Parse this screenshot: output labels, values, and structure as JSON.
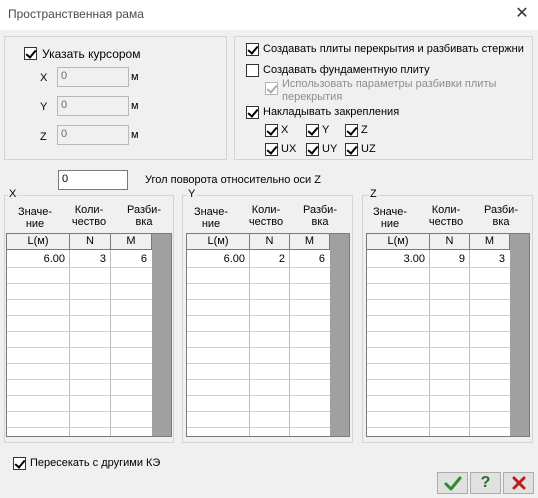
{
  "window": {
    "title": "Пространственная рама",
    "close_glyph": "✕"
  },
  "cursor_group": {
    "checkbox_label": "Указать курсором",
    "checked": true,
    "fields": [
      {
        "axis": "X",
        "value": "0",
        "unit": "м"
      },
      {
        "axis": "Y",
        "value": "0",
        "unit": "м"
      },
      {
        "axis": "Z",
        "value": "0",
        "unit": "м"
      }
    ]
  },
  "options_group": {
    "create_slabs": {
      "label": "Создавать плиты перекрытия и разбивать стержни",
      "checked": true
    },
    "create_foundation": {
      "label": "Создавать фундаментную плиту",
      "checked": false
    },
    "use_params": {
      "label_line1": "Использовать параметры разбивки плиты",
      "label_line2": "перекрытия",
      "checked": true,
      "disabled": true
    },
    "apply_constraints": {
      "label": "Накладывать закрепления",
      "checked": true
    },
    "constraints": [
      {
        "label": "X",
        "checked": true
      },
      {
        "label": "Y",
        "checked": true
      },
      {
        "label": "Z",
        "checked": true
      },
      {
        "label": "UX",
        "checked": true
      },
      {
        "label": "UY",
        "checked": true
      },
      {
        "label": "UZ",
        "checked": true
      }
    ]
  },
  "rotation": {
    "value": "0",
    "label": "Угол поворота относительно оси Z"
  },
  "panels": [
    {
      "letter": "X",
      "headers": [
        [
          "Значе-",
          "ние"
        ],
        [
          "Коли-",
          "чество"
        ],
        [
          "Разби-",
          "вка"
        ]
      ],
      "columns": [
        "L(м)",
        "N",
        "M"
      ],
      "rows": [
        [
          "6.00",
          "3",
          "6"
        ]
      ]
    },
    {
      "letter": "Y",
      "headers": [
        [
          "Значе-",
          "ние"
        ],
        [
          "Коли-",
          "чество"
        ],
        [
          "Разби-",
          "вка"
        ]
      ],
      "columns": [
        "L(м)",
        "N",
        "M"
      ],
      "rows": [
        [
          "6.00",
          "2",
          "6"
        ]
      ]
    },
    {
      "letter": "Z",
      "headers": [
        [
          "Значе-",
          "ние"
        ],
        [
          "Коли-",
          "чество"
        ],
        [
          "Разби-",
          "вка"
        ]
      ],
      "columns": [
        "L(м)",
        "N",
        "M"
      ],
      "rows": [
        [
          "3.00",
          "9",
          "3"
        ]
      ]
    }
  ],
  "intersect": {
    "label": "Пересекать с другими КЭ",
    "checked": true
  },
  "buttons": {
    "ok": "ok-checkmark",
    "help": "?",
    "cancel": "cancel-cross"
  },
  "colors": {
    "ok": "#2e8b2e",
    "help": "#2b6a2b",
    "cancel": "#c21a1a"
  }
}
